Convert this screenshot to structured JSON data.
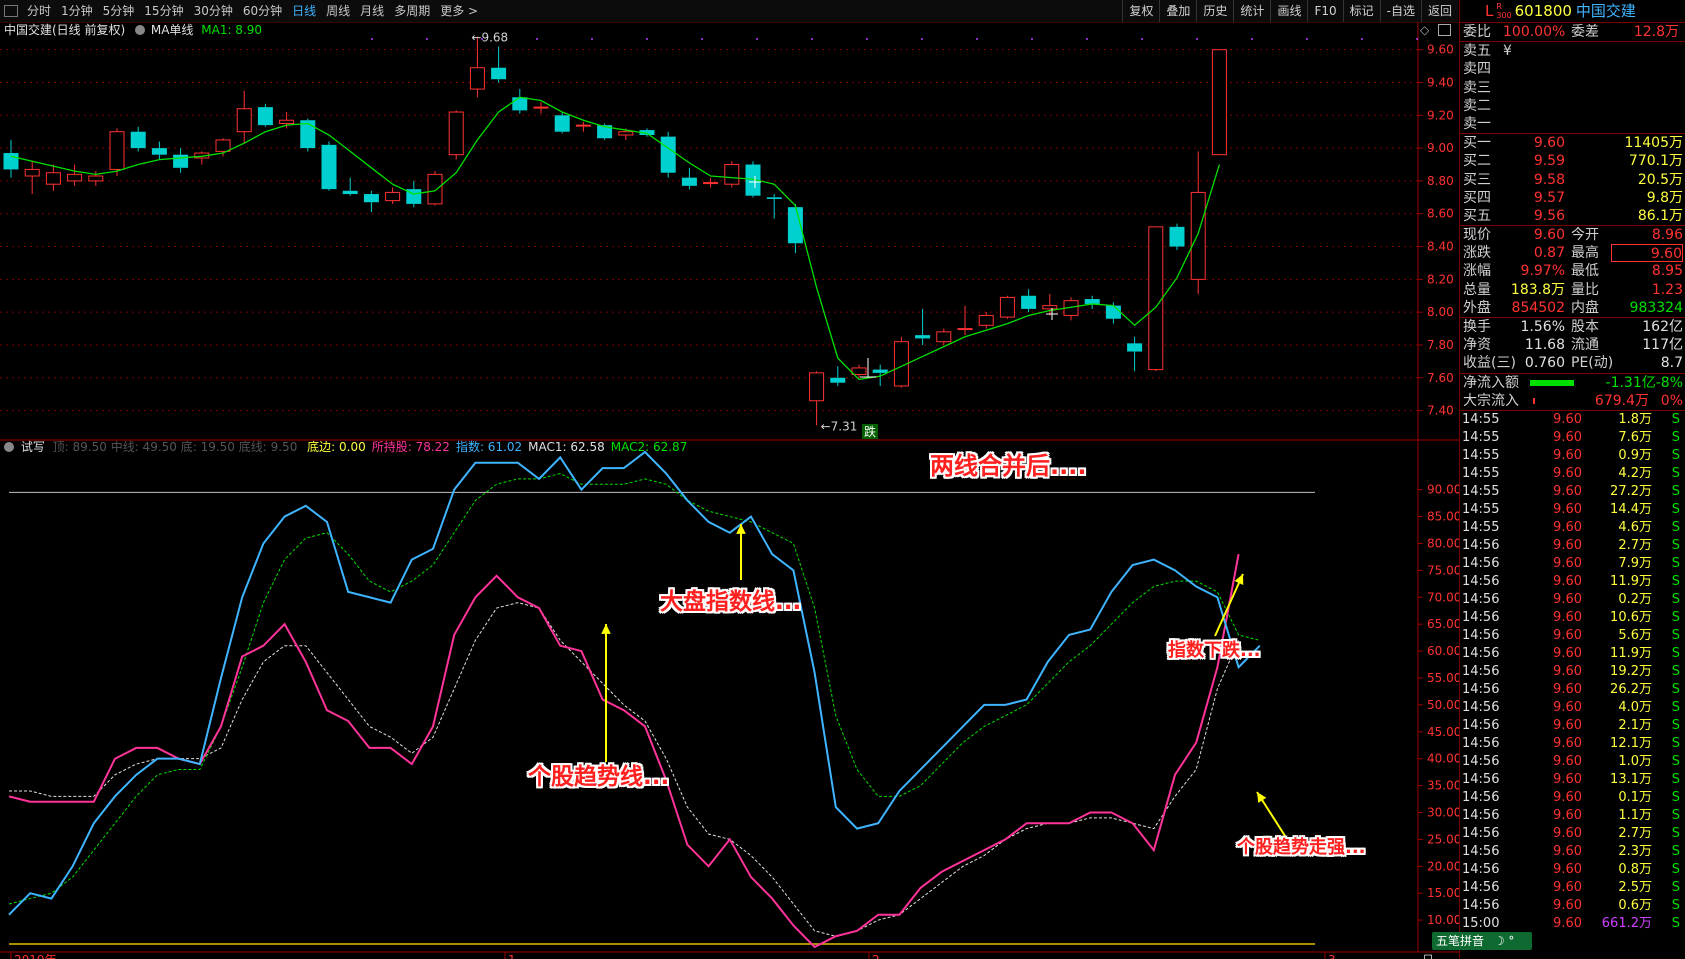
{
  "toolbar": {
    "periods": [
      "分时",
      "1分钟",
      "5分钟",
      "15分钟",
      "30分钟",
      "60分钟",
      "日线",
      "周线",
      "月线",
      "多周期",
      "更多 >"
    ],
    "active_index": 6,
    "right_buttons": [
      "复权",
      "叠加",
      "历史",
      "统计",
      "画线",
      "F10",
      "标记",
      "-自选",
      "返回"
    ]
  },
  "stock": {
    "prefix": "L",
    "badge_top": "R",
    "badge_bottom": "300",
    "code": "601800",
    "name": "中国交建"
  },
  "main_chart": {
    "title": "中国交建(日线 前复权)",
    "ma_label": "MA单线",
    "ma1_text": "MA1: 8.90",
    "high_label": "9.68",
    "low_label": "7.31",
    "die_label": "跌",
    "y_ticks": [
      "9.60",
      "9.40",
      "9.20",
      "9.00",
      "8.80",
      "8.60",
      "8.40",
      "8.20",
      "8.00",
      "7.80",
      "7.60",
      "7.40"
    ]
  },
  "indicator": {
    "name": "试写",
    "faded_text": "顶: 89.50  中线: 49.50  底: 19.50  底线: 9.50",
    "items": [
      {
        "text": "底边: 0.00",
        "color": "#ffff40"
      },
      {
        "text": "所持股: 78.22",
        "color": "#ff3399"
      },
      {
        "text": "指数: 61.02",
        "color": "#3fb4ff"
      },
      {
        "text": "MAC1: 62.58",
        "color": "#e0e0e0"
      },
      {
        "text": "MAC2: 62.87",
        "color": "#00e000"
      }
    ],
    "y_ticks": [
      "90.00",
      "85.00",
      "80.00",
      "75.00",
      "70.00",
      "65.00",
      "60.00",
      "55.00",
      "50.00",
      "45.00",
      "40.00",
      "35.00",
      "30.00",
      "25.00",
      "20.00",
      "15.00",
      "10.00"
    ]
  },
  "x_axis": {
    "labels": [
      "2019年",
      "1",
      "2",
      "3"
    ],
    "right_label": "日"
  },
  "annotations": {
    "merge": "两线合并后....",
    "index_line": "大盘指数线...",
    "stock_trend": "个股趋势线...",
    "index_fall": "指数下跌...",
    "stock_strong": "个股趋势走强..."
  },
  "colors": {
    "up": "#ff3232",
    "down": "#00d0d0",
    "ma": "#00e000",
    "stock_line": "#ff3399",
    "index_line": "#3fb4ff",
    "grid": "#7a0000"
  },
  "chart_data": {
    "type": "candlestick",
    "ylim": [
      7.3,
      9.72
    ],
    "candles": [
      {
        "o": 8.97,
        "h": 9.05,
        "l": 8.82,
        "c": 8.87
      },
      {
        "o": 8.83,
        "h": 8.92,
        "l": 8.72,
        "c": 8.87
      },
      {
        "o": 8.78,
        "h": 8.9,
        "l": 8.74,
        "c": 8.85
      },
      {
        "o": 8.8,
        "h": 8.9,
        "l": 8.77,
        "c": 8.84
      },
      {
        "o": 8.8,
        "h": 8.86,
        "l": 8.77,
        "c": 8.83
      },
      {
        "o": 8.87,
        "h": 9.12,
        "l": 8.83,
        "c": 9.1
      },
      {
        "o": 9.1,
        "h": 9.13,
        "l": 8.98,
        "c": 9.0
      },
      {
        "o": 9.0,
        "h": 9.04,
        "l": 8.93,
        "c": 8.96
      },
      {
        "o": 8.96,
        "h": 9.0,
        "l": 8.85,
        "c": 8.88
      },
      {
        "o": 8.94,
        "h": 8.98,
        "l": 8.9,
        "c": 8.97
      },
      {
        "o": 8.98,
        "h": 9.06,
        "l": 8.95,
        "c": 9.05
      },
      {
        "o": 9.1,
        "h": 9.35,
        "l": 9.03,
        "c": 9.24
      },
      {
        "o": 9.25,
        "h": 9.27,
        "l": 9.13,
        "c": 9.14
      },
      {
        "o": 9.15,
        "h": 9.22,
        "l": 9.12,
        "c": 9.17
      },
      {
        "o": 9.17,
        "h": 9.18,
        "l": 8.98,
        "c": 9.0
      },
      {
        "o": 9.02,
        "h": 9.04,
        "l": 8.74,
        "c": 8.75
      },
      {
        "o": 8.74,
        "h": 8.82,
        "l": 8.71,
        "c": 8.72
      },
      {
        "o": 8.72,
        "h": 8.74,
        "l": 8.61,
        "c": 8.67
      },
      {
        "o": 8.68,
        "h": 8.76,
        "l": 8.66,
        "c": 8.73
      },
      {
        "o": 8.75,
        "h": 8.8,
        "l": 8.64,
        "c": 8.66
      },
      {
        "o": 8.66,
        "h": 8.86,
        "l": 8.65,
        "c": 8.84
      },
      {
        "o": 8.96,
        "h": 9.23,
        "l": 8.93,
        "c": 9.22
      },
      {
        "o": 9.36,
        "h": 9.68,
        "l": 9.31,
        "c": 9.49
      },
      {
        "o": 9.49,
        "h": 9.62,
        "l": 9.4,
        "c": 9.42
      },
      {
        "o": 9.31,
        "h": 9.36,
        "l": 9.21,
        "c": 9.23
      },
      {
        "o": 9.25,
        "h": 9.28,
        "l": 9.21,
        "c": 9.25
      },
      {
        "o": 9.2,
        "h": 9.22,
        "l": 9.09,
        "c": 9.1
      },
      {
        "o": 9.14,
        "h": 9.16,
        "l": 9.1,
        "c": 9.14
      },
      {
        "o": 9.14,
        "h": 9.15,
        "l": 9.05,
        "c": 9.06
      },
      {
        "o": 9.08,
        "h": 9.12,
        "l": 9.05,
        "c": 9.1
      },
      {
        "o": 9.11,
        "h": 9.12,
        "l": 9.07,
        "c": 9.08
      },
      {
        "o": 9.07,
        "h": 9.1,
        "l": 8.82,
        "c": 8.85
      },
      {
        "o": 8.82,
        "h": 8.88,
        "l": 8.75,
        "c": 8.77
      },
      {
        "o": 8.79,
        "h": 8.82,
        "l": 8.76,
        "c": 8.79
      },
      {
        "o": 8.78,
        "h": 8.92,
        "l": 8.76,
        "c": 8.9
      },
      {
        "o": 8.9,
        "h": 8.92,
        "l": 8.7,
        "c": 8.71
      },
      {
        "o": 8.7,
        "h": 8.72,
        "l": 8.57,
        "c": 8.69
      },
      {
        "o": 8.64,
        "h": 8.66,
        "l": 8.36,
        "c": 8.42
      },
      {
        "o": 7.46,
        "h": 7.64,
        "l": 7.31,
        "c": 7.63
      },
      {
        "o": 7.6,
        "h": 7.67,
        "l": 7.55,
        "c": 7.57
      },
      {
        "o": 7.62,
        "h": 7.68,
        "l": 7.6,
        "c": 7.66
      },
      {
        "o": 7.65,
        "h": 7.68,
        "l": 7.55,
        "c": 7.63
      },
      {
        "o": 7.55,
        "h": 7.85,
        "l": 7.54,
        "c": 7.82
      },
      {
        "o": 7.86,
        "h": 8.02,
        "l": 7.8,
        "c": 7.84
      },
      {
        "o": 7.82,
        "h": 7.9,
        "l": 7.8,
        "c": 7.88
      },
      {
        "o": 7.9,
        "h": 8.04,
        "l": 7.86,
        "c": 7.9
      },
      {
        "o": 7.92,
        "h": 8.0,
        "l": 7.9,
        "c": 7.98
      },
      {
        "o": 7.97,
        "h": 8.1,
        "l": 7.96,
        "c": 8.09
      },
      {
        "o": 8.1,
        "h": 8.14,
        "l": 8.0,
        "c": 8.02
      },
      {
        "o": 8.02,
        "h": 8.11,
        "l": 7.98,
        "c": 8.04
      },
      {
        "o": 7.98,
        "h": 8.09,
        "l": 7.95,
        "c": 8.07
      },
      {
        "o": 8.08,
        "h": 8.1,
        "l": 8.02,
        "c": 8.05
      },
      {
        "o": 8.04,
        "h": 8.06,
        "l": 7.93,
        "c": 7.96
      },
      {
        "o": 7.81,
        "h": 7.85,
        "l": 7.64,
        "c": 7.76
      },
      {
        "o": 7.65,
        "h": 8.52,
        "l": 7.64,
        "c": 8.52
      },
      {
        "o": 8.52,
        "h": 8.54,
        "l": 8.38,
        "c": 8.4
      },
      {
        "o": 8.2,
        "h": 8.98,
        "l": 8.11,
        "c": 8.73
      },
      {
        "o": 8.96,
        "h": 9.6,
        "l": 8.96,
        "c": 9.6
      }
    ],
    "ma1": [
      8.95,
      8.92,
      8.89,
      8.86,
      8.84,
      8.86,
      8.9,
      8.93,
      8.94,
      8.95,
      8.97,
      9.03,
      9.1,
      9.14,
      9.15,
      9.08,
      8.98,
      8.88,
      8.78,
      8.72,
      8.74,
      8.85,
      9.05,
      9.22,
      9.31,
      9.29,
      9.22,
      9.17,
      9.13,
      9.11,
      9.09,
      9.0,
      8.91,
      8.83,
      8.82,
      8.81,
      8.78,
      8.65,
      8.15,
      7.72,
      7.59,
      7.61,
      7.67,
      7.73,
      7.79,
      7.85,
      7.89,
      7.93,
      7.98,
      8.01,
      8.03,
      8.05,
      8.04,
      7.92,
      8.03,
      8.21,
      8.48,
      8.9
    ],
    "indicator_ylim": [
      5,
      97
    ],
    "stock_line": [
      33,
      32,
      32,
      32,
      32,
      40,
      42,
      42,
      40,
      39,
      46,
      59,
      61,
      65,
      58,
      49,
      47,
      42,
      42,
      39,
      46,
      63,
      70,
      74,
      70,
      68,
      61,
      60,
      51,
      49,
      46,
      36,
      24,
      20,
      25,
      18,
      14,
      9,
      5,
      7,
      8,
      11,
      11,
      16,
      19,
      21,
      23,
      25,
      28,
      28,
      28,
      30,
      30,
      28,
      23,
      37,
      43,
      57,
      78
    ],
    "index_line": [
      11,
      15,
      14,
      20,
      28,
      33,
      37,
      40,
      40,
      39,
      55,
      70,
      80,
      85,
      87,
      84,
      71,
      70,
      69,
      77,
      79,
      90,
      95,
      95,
      95,
      92,
      96,
      90,
      94,
      94,
      97,
      93,
      88,
      84,
      82,
      85,
      78,
      75,
      56,
      31,
      27,
      28,
      34,
      38,
      42,
      46,
      50,
      50,
      51,
      58,
      63,
      64,
      71,
      76,
      77,
      75,
      72,
      70,
      57,
      61
    ],
    "mac1": [
      34,
      34,
      33,
      33,
      33,
      37,
      39,
      40,
      40,
      40,
      42,
      51,
      58,
      61,
      61,
      56,
      51,
      46,
      44,
      41,
      44,
      53,
      62,
      68,
      69,
      68,
      62,
      58,
      54,
      50,
      47,
      40,
      31,
      26,
      25,
      22,
      18,
      13,
      8,
      7,
      8,
      10,
      11,
      14,
      17,
      20,
      22,
      25,
      27,
      28,
      28,
      29,
      29,
      28,
      27,
      33,
      38,
      53,
      62
    ],
    "mac2": [
      13,
      14,
      15,
      18,
      23,
      28,
      33,
      37,
      38,
      38,
      46,
      57,
      69,
      77,
      81,
      82,
      78,
      73,
      71,
      73,
      76,
      82,
      88,
      91,
      92,
      92,
      93,
      91,
      91,
      91,
      92,
      91,
      88,
      86,
      85,
      84,
      82,
      80,
      68,
      48,
      38,
      33,
      33,
      35,
      39,
      43,
      46,
      48,
      50,
      54,
      58,
      61,
      65,
      69,
      72,
      73,
      73,
      71,
      63,
      62
    ],
    "merge_level": 89.5
  },
  "quote_panel": {
    "wei_bi_label": "委比",
    "wei_bi": "100.00%",
    "wei_cha_label": "委差",
    "wei_cha": "12.8万",
    "sells": [
      {
        "label": "卖五",
        "price": "¥",
        "vol": ""
      },
      {
        "label": "卖四",
        "price": "",
        "vol": ""
      },
      {
        "label": "卖三",
        "price": "",
        "vol": ""
      },
      {
        "label": "卖二",
        "price": "",
        "vol": ""
      },
      {
        "label": "卖一",
        "price": "",
        "vol": ""
      }
    ],
    "buys": [
      {
        "label": "买一",
        "price": "9.60",
        "vol": "11405万"
      },
      {
        "label": "买二",
        "price": "9.59",
        "vol": "770.1万"
      },
      {
        "label": "买三",
        "price": "9.58",
        "vol": "20.5万"
      },
      {
        "label": "买四",
        "price": "9.57",
        "vol": "9.8万"
      },
      {
        "label": "买五",
        "price": "9.56",
        "vol": "86.1万"
      }
    ],
    "stats": [
      {
        "l1": "现价",
        "v1": "9.60",
        "c1": "red",
        "l2": "今开",
        "v2": "8.96",
        "c2": "red"
      },
      {
        "l1": "涨跌",
        "v1": "0.87",
        "c1": "red",
        "l2": "最高",
        "v2": "9.60",
        "c2": "red"
      },
      {
        "l1": "涨幅",
        "v1": "9.97%",
        "c1": "red",
        "l2": "最低",
        "v2": "8.95",
        "c2": "red"
      },
      {
        "l1": "总量",
        "v1": "183.8万",
        "c1": "yel",
        "l2": "量比",
        "v2": "1.23",
        "c2": "red"
      },
      {
        "l1": "外盘",
        "v1": "854502",
        "c1": "red",
        "l2": "内盘",
        "v2": "983324",
        "c2": "grn"
      }
    ],
    "stats2": [
      {
        "l1": "换手",
        "v1": "1.56%",
        "l2": "股本",
        "v2": "162亿"
      },
      {
        "l1": "净资",
        "v1": "11.68",
        "l2": "流通",
        "v2": "117亿"
      },
      {
        "l1": "收益(三)",
        "v1": "0.760",
        "l2": "PE(动)",
        "v2": "8.7"
      }
    ],
    "flow": [
      {
        "label": "净流入额",
        "value": "-1.31亿",
        "pct": "-8%",
        "color": "grn"
      },
      {
        "label": "大宗流入",
        "value": "679.4万",
        "pct": "0%",
        "color": "red"
      }
    ],
    "ticks": [
      {
        "t": "14:55",
        "p": "9.60",
        "v": "1.8万",
        "s": "S"
      },
      {
        "t": "14:55",
        "p": "9.60",
        "v": "7.6万",
        "s": "S"
      },
      {
        "t": "14:55",
        "p": "9.60",
        "v": "0.9万",
        "s": "S"
      },
      {
        "t": "14:55",
        "p": "9.60",
        "v": "4.2万",
        "s": "S"
      },
      {
        "t": "14:55",
        "p": "9.60",
        "v": "27.2万",
        "s": "S"
      },
      {
        "t": "14:55",
        "p": "9.60",
        "v": "14.4万",
        "s": "S"
      },
      {
        "t": "14:55",
        "p": "9.60",
        "v": "4.6万",
        "s": "S"
      },
      {
        "t": "14:56",
        "p": "9.60",
        "v": "2.7万",
        "s": "S"
      },
      {
        "t": "14:56",
        "p": "9.60",
        "v": "7.9万",
        "s": "S"
      },
      {
        "t": "14:56",
        "p": "9.60",
        "v": "11.9万",
        "s": "S"
      },
      {
        "t": "14:56",
        "p": "9.60",
        "v": "0.2万",
        "s": "S"
      },
      {
        "t": "14:56",
        "p": "9.60",
        "v": "10.6万",
        "s": "S"
      },
      {
        "t": "14:56",
        "p": "9.60",
        "v": "5.6万",
        "s": "S"
      },
      {
        "t": "14:56",
        "p": "9.60",
        "v": "11.9万",
        "s": "S"
      },
      {
        "t": "14:56",
        "p": "9.60",
        "v": "19.2万",
        "s": "S"
      },
      {
        "t": "14:56",
        "p": "9.60",
        "v": "26.2万",
        "s": "S"
      },
      {
        "t": "14:56",
        "p": "9.60",
        "v": "4.0万",
        "s": "S"
      },
      {
        "t": "14:56",
        "p": "9.60",
        "v": "2.1万",
        "s": "S"
      },
      {
        "t": "14:56",
        "p": "9.60",
        "v": "12.1万",
        "s": "S"
      },
      {
        "t": "14:56",
        "p": "9.60",
        "v": "1.0万",
        "s": "S"
      },
      {
        "t": "14:56",
        "p": "9.60",
        "v": "13.1万",
        "s": "S"
      },
      {
        "t": "14:56",
        "p": "9.60",
        "v": "0.1万",
        "s": "S"
      },
      {
        "t": "14:56",
        "p": "9.60",
        "v": "1.1万",
        "s": "S"
      },
      {
        "t": "14:56",
        "p": "9.60",
        "v": "2.7万",
        "s": "S"
      },
      {
        "t": "14:56",
        "p": "9.60",
        "v": "2.3万",
        "s": "S"
      },
      {
        "t": "14:56",
        "p": "9.60",
        "v": "0.8万",
        "s": "S"
      },
      {
        "t": "14:56",
        "p": "9.60",
        "v": "2.5万",
        "s": "S"
      },
      {
        "t": "14:56",
        "p": "9.60",
        "v": "0.6万",
        "s": "S"
      },
      {
        "t": "15:00",
        "p": "9.60",
        "v": "661.2万",
        "s": "S"
      }
    ],
    "ime_label": "五笔拼音"
  }
}
